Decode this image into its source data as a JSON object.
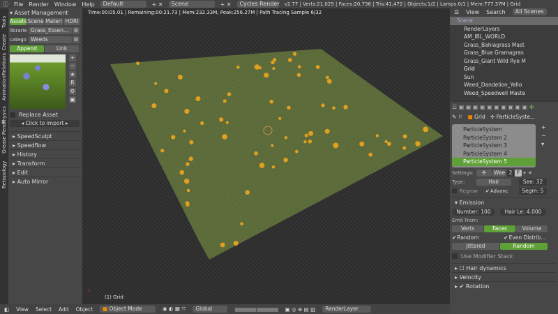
{
  "topbar": {
    "menus": [
      "File",
      "Render",
      "Window",
      "Help"
    ],
    "layout": "Default",
    "scene": "Scene",
    "engine": "Cycles Render",
    "stats": "v2.77 | Verts:21,025 | Faces:20,736 | Tris:41,472 | Objects:1/2 | Lamps:0/1 | Mem:777.37M | Grid"
  },
  "lefttabs": [
    "Tools",
    "Create",
    "Relations",
    "Animation",
    "Physics",
    "Grease Pencil",
    "Retopology"
  ],
  "asset": {
    "title": "Asset Management",
    "tabs": [
      "Assets",
      "Scene",
      "Materi",
      "HDRI"
    ],
    "library_label": "librarie",
    "library": "Grass_Essen...",
    "category_label": "catego",
    "category": "Weeds",
    "append": "Append",
    "link": "Link",
    "replace": "Replace Asset",
    "import": "Click to import"
  },
  "panels": [
    "SpeedSculpt",
    "Speedflow",
    "History",
    "Transform",
    "Edit",
    "Auto Mirror"
  ],
  "viewport": {
    "status": "Time:00:05.01 | Remaining:00:21.73 | Mem:232.33M, Peak:256.27M | Path Tracing Sample 6/32",
    "object": "(1) Grid",
    "grass_color": "#4f5a2c",
    "flower_color": "#e0a020"
  },
  "outliner": {
    "tabs": [
      "View",
      "Search",
      "All Scenes"
    ],
    "items": [
      "Scene",
      "RenderLayers",
      "AM_IBL_WORLD",
      "Grass_Bahiagrass Mast",
      "Grass_Blue Gramagras",
      "Grass_Giant Wild Rye M",
      "Grid",
      "Sun",
      "Weed_Dandelion_Yello",
      "Weed_Speedwell Maste"
    ]
  },
  "props": {
    "object": "Grid",
    "psys": "ParticleSyste...",
    "systems": [
      "ParticleSystem",
      "ParticleSystem 2",
      "ParticleSystem 3",
      "ParticleSystem 4",
      "ParticleSystem 5"
    ],
    "settings_label": "Settings:",
    "settings_name": "Wee",
    "settings_users": "2",
    "settings_f": "F",
    "type_label": "Type:",
    "type": "Hair",
    "seed": "See: 32",
    "regrow": "Regrow",
    "advanced": "Advanc",
    "segments": "Segm: 5",
    "emission": "Emission",
    "number": "Number:  100",
    "hair_len": "Hair Le: 4.000",
    "emit_from": "Emit From:",
    "emit_opts": [
      "Verts",
      "Faces",
      "Volume"
    ],
    "random": "Random",
    "even": "Even Distrib...",
    "dist_opts": [
      "Jittered",
      "Random"
    ],
    "modifier_stack": "Use Modifier Stack",
    "hair_dynamics": "Hair dynamics",
    "velocity": "Velocity",
    "rotation": "Rotation"
  },
  "bottombar": {
    "items": [
      "View",
      "Select",
      "Add",
      "Object"
    ],
    "mode": "Object Mode",
    "orientation": "Global",
    "renderlayer": "RenderLayer"
  },
  "accent": "#5f9f37"
}
